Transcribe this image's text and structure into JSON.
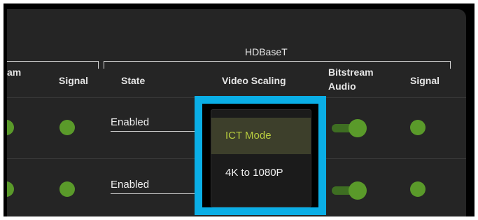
{
  "group": {
    "title": "HDBaseT"
  },
  "columns": {
    "partial_stream": "am",
    "signal_left": "Signal",
    "state": "State",
    "video_scaling": "Video Scaling",
    "bitstream_audio": "Bitstream Audio",
    "signal_right": "Signal"
  },
  "rows": [
    {
      "state_value": "Enabled"
    },
    {
      "state_value": "Enabled"
    }
  ],
  "video_scaling_dropdown": {
    "options": [
      "ICT Mode",
      "4K to 1080P"
    ],
    "selected": "ICT Mode"
  },
  "colors": {
    "status_green": "#5a9a2a",
    "highlight_blue": "#0aaee6",
    "selected_text": "#b8cc3e"
  }
}
